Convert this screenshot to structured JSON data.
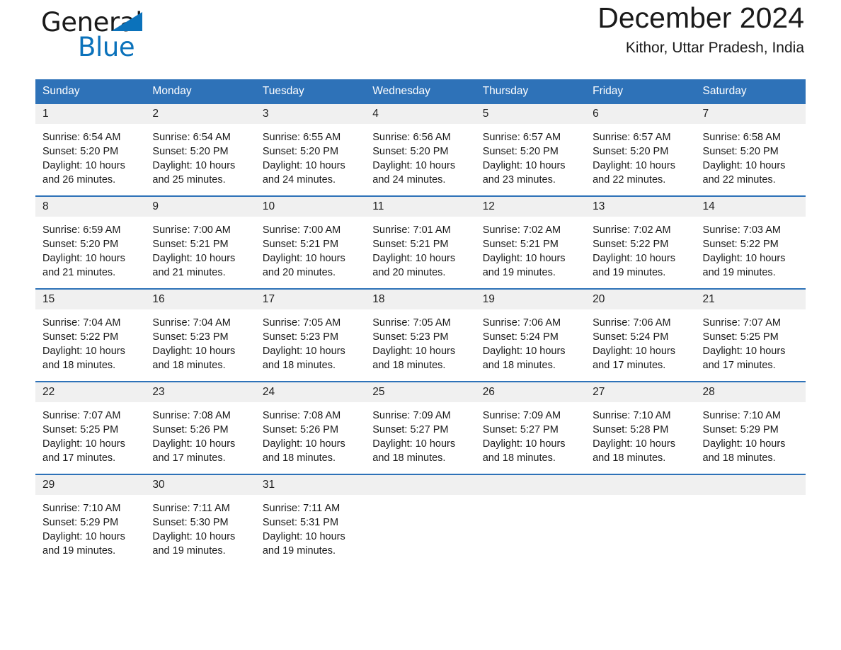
{
  "brand": {
    "name_part1": "General",
    "name_part2": "Blue",
    "logo_icon": "triangle-flag-icon",
    "accent_color": "#0b72bb"
  },
  "header": {
    "title": "December 2024",
    "location": "Kithor, Uttar Pradesh, India"
  },
  "colors": {
    "header_blue": "#2e72b8",
    "daynum_band": "#f0f0f0",
    "text": "#1a1a1a"
  },
  "weekdays": [
    "Sunday",
    "Monday",
    "Tuesday",
    "Wednesday",
    "Thursday",
    "Friday",
    "Saturday"
  ],
  "weeks": [
    [
      {
        "day": "1",
        "sunrise": "Sunrise: 6:54 AM",
        "sunset": "Sunset: 5:20 PM",
        "daylight1": "Daylight: 10 hours",
        "daylight2": "and 26 minutes."
      },
      {
        "day": "2",
        "sunrise": "Sunrise: 6:54 AM",
        "sunset": "Sunset: 5:20 PM",
        "daylight1": "Daylight: 10 hours",
        "daylight2": "and 25 minutes."
      },
      {
        "day": "3",
        "sunrise": "Sunrise: 6:55 AM",
        "sunset": "Sunset: 5:20 PM",
        "daylight1": "Daylight: 10 hours",
        "daylight2": "and 24 minutes."
      },
      {
        "day": "4",
        "sunrise": "Sunrise: 6:56 AM",
        "sunset": "Sunset: 5:20 PM",
        "daylight1": "Daylight: 10 hours",
        "daylight2": "and 24 minutes."
      },
      {
        "day": "5",
        "sunrise": "Sunrise: 6:57 AM",
        "sunset": "Sunset: 5:20 PM",
        "daylight1": "Daylight: 10 hours",
        "daylight2": "and 23 minutes."
      },
      {
        "day": "6",
        "sunrise": "Sunrise: 6:57 AM",
        "sunset": "Sunset: 5:20 PM",
        "daylight1": "Daylight: 10 hours",
        "daylight2": "and 22 minutes."
      },
      {
        "day": "7",
        "sunrise": "Sunrise: 6:58 AM",
        "sunset": "Sunset: 5:20 PM",
        "daylight1": "Daylight: 10 hours",
        "daylight2": "and 22 minutes."
      }
    ],
    [
      {
        "day": "8",
        "sunrise": "Sunrise: 6:59 AM",
        "sunset": "Sunset: 5:20 PM",
        "daylight1": "Daylight: 10 hours",
        "daylight2": "and 21 minutes."
      },
      {
        "day": "9",
        "sunrise": "Sunrise: 7:00 AM",
        "sunset": "Sunset: 5:21 PM",
        "daylight1": "Daylight: 10 hours",
        "daylight2": "and 21 minutes."
      },
      {
        "day": "10",
        "sunrise": "Sunrise: 7:00 AM",
        "sunset": "Sunset: 5:21 PM",
        "daylight1": "Daylight: 10 hours",
        "daylight2": "and 20 minutes."
      },
      {
        "day": "11",
        "sunrise": "Sunrise: 7:01 AM",
        "sunset": "Sunset: 5:21 PM",
        "daylight1": "Daylight: 10 hours",
        "daylight2": "and 20 minutes."
      },
      {
        "day": "12",
        "sunrise": "Sunrise: 7:02 AM",
        "sunset": "Sunset: 5:21 PM",
        "daylight1": "Daylight: 10 hours",
        "daylight2": "and 19 minutes."
      },
      {
        "day": "13",
        "sunrise": "Sunrise: 7:02 AM",
        "sunset": "Sunset: 5:22 PM",
        "daylight1": "Daylight: 10 hours",
        "daylight2": "and 19 minutes."
      },
      {
        "day": "14",
        "sunrise": "Sunrise: 7:03 AM",
        "sunset": "Sunset: 5:22 PM",
        "daylight1": "Daylight: 10 hours",
        "daylight2": "and 19 minutes."
      }
    ],
    [
      {
        "day": "15",
        "sunrise": "Sunrise: 7:04 AM",
        "sunset": "Sunset: 5:22 PM",
        "daylight1": "Daylight: 10 hours",
        "daylight2": "and 18 minutes."
      },
      {
        "day": "16",
        "sunrise": "Sunrise: 7:04 AM",
        "sunset": "Sunset: 5:23 PM",
        "daylight1": "Daylight: 10 hours",
        "daylight2": "and 18 minutes."
      },
      {
        "day": "17",
        "sunrise": "Sunrise: 7:05 AM",
        "sunset": "Sunset: 5:23 PM",
        "daylight1": "Daylight: 10 hours",
        "daylight2": "and 18 minutes."
      },
      {
        "day": "18",
        "sunrise": "Sunrise: 7:05 AM",
        "sunset": "Sunset: 5:23 PM",
        "daylight1": "Daylight: 10 hours",
        "daylight2": "and 18 minutes."
      },
      {
        "day": "19",
        "sunrise": "Sunrise: 7:06 AM",
        "sunset": "Sunset: 5:24 PM",
        "daylight1": "Daylight: 10 hours",
        "daylight2": "and 18 minutes."
      },
      {
        "day": "20",
        "sunrise": "Sunrise: 7:06 AM",
        "sunset": "Sunset: 5:24 PM",
        "daylight1": "Daylight: 10 hours",
        "daylight2": "and 17 minutes."
      },
      {
        "day": "21",
        "sunrise": "Sunrise: 7:07 AM",
        "sunset": "Sunset: 5:25 PM",
        "daylight1": "Daylight: 10 hours",
        "daylight2": "and 17 minutes."
      }
    ],
    [
      {
        "day": "22",
        "sunrise": "Sunrise: 7:07 AM",
        "sunset": "Sunset: 5:25 PM",
        "daylight1": "Daylight: 10 hours",
        "daylight2": "and 17 minutes."
      },
      {
        "day": "23",
        "sunrise": "Sunrise: 7:08 AM",
        "sunset": "Sunset: 5:26 PM",
        "daylight1": "Daylight: 10 hours",
        "daylight2": "and 17 minutes."
      },
      {
        "day": "24",
        "sunrise": "Sunrise: 7:08 AM",
        "sunset": "Sunset: 5:26 PM",
        "daylight1": "Daylight: 10 hours",
        "daylight2": "and 18 minutes."
      },
      {
        "day": "25",
        "sunrise": "Sunrise: 7:09 AM",
        "sunset": "Sunset: 5:27 PM",
        "daylight1": "Daylight: 10 hours",
        "daylight2": "and 18 minutes."
      },
      {
        "day": "26",
        "sunrise": "Sunrise: 7:09 AM",
        "sunset": "Sunset: 5:27 PM",
        "daylight1": "Daylight: 10 hours",
        "daylight2": "and 18 minutes."
      },
      {
        "day": "27",
        "sunrise": "Sunrise: 7:10 AM",
        "sunset": "Sunset: 5:28 PM",
        "daylight1": "Daylight: 10 hours",
        "daylight2": "and 18 minutes."
      },
      {
        "day": "28",
        "sunrise": "Sunrise: 7:10 AM",
        "sunset": "Sunset: 5:29 PM",
        "daylight1": "Daylight: 10 hours",
        "daylight2": "and 18 minutes."
      }
    ],
    [
      {
        "day": "29",
        "sunrise": "Sunrise: 7:10 AM",
        "sunset": "Sunset: 5:29 PM",
        "daylight1": "Daylight: 10 hours",
        "daylight2": "and 19 minutes."
      },
      {
        "day": "30",
        "sunrise": "Sunrise: 7:11 AM",
        "sunset": "Sunset: 5:30 PM",
        "daylight1": "Daylight: 10 hours",
        "daylight2": "and 19 minutes."
      },
      {
        "day": "31",
        "sunrise": "Sunrise: 7:11 AM",
        "sunset": "Sunset: 5:31 PM",
        "daylight1": "Daylight: 10 hours",
        "daylight2": "and 19 minutes."
      },
      {
        "day": "",
        "sunrise": "",
        "sunset": "",
        "daylight1": "",
        "daylight2": ""
      },
      {
        "day": "",
        "sunrise": "",
        "sunset": "",
        "daylight1": "",
        "daylight2": ""
      },
      {
        "day": "",
        "sunrise": "",
        "sunset": "",
        "daylight1": "",
        "daylight2": ""
      },
      {
        "day": "",
        "sunrise": "",
        "sunset": "",
        "daylight1": "",
        "daylight2": ""
      }
    ]
  ]
}
